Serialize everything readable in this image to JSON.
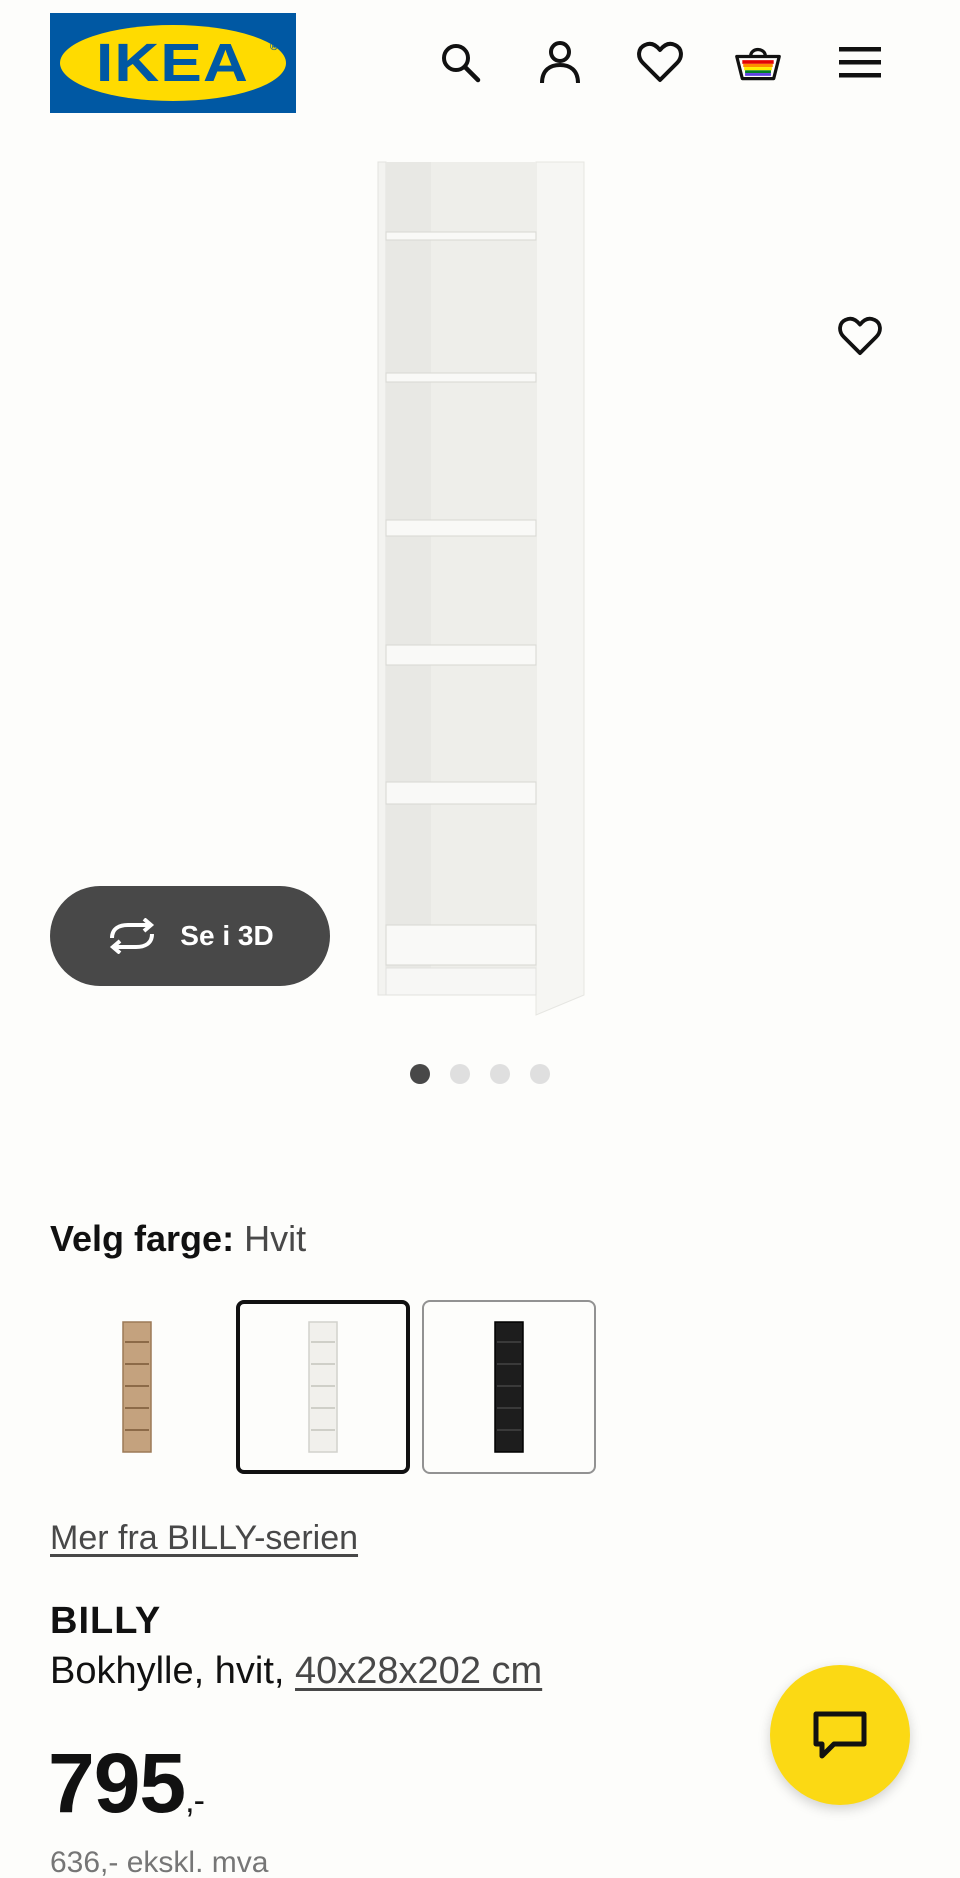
{
  "header": {
    "logo_text": "IKEA",
    "logo_reg": "®",
    "icons": [
      "search-icon",
      "account-icon",
      "heart-icon",
      "basket-icon",
      "menu-icon"
    ]
  },
  "gallery": {
    "view_3d_label": "Se i 3D",
    "slide_count": 4,
    "active_slide": 1
  },
  "color_picker": {
    "label": "Velg farge:",
    "selected_value": "Hvit",
    "options": [
      {
        "color": "#b89572",
        "selected": false
      },
      {
        "color": "#f1f0ec",
        "selected": true
      },
      {
        "color": "#1d1d1d",
        "selected": false
      }
    ]
  },
  "series_link": "Mer fra BILLY-serien",
  "product": {
    "name": "BILLY",
    "description": "Bokhylle, hvit,",
    "dimensions": "40x28x202 cm",
    "price": "795",
    "price_suffix": ",-",
    "sub_price": "636,- ekskl. mva"
  },
  "colors": {
    "ikea_blue": "#0058a3",
    "ikea_yellow": "#ffdb00",
    "chat_yellow": "#fbd914",
    "dark_grey": "#484848"
  }
}
